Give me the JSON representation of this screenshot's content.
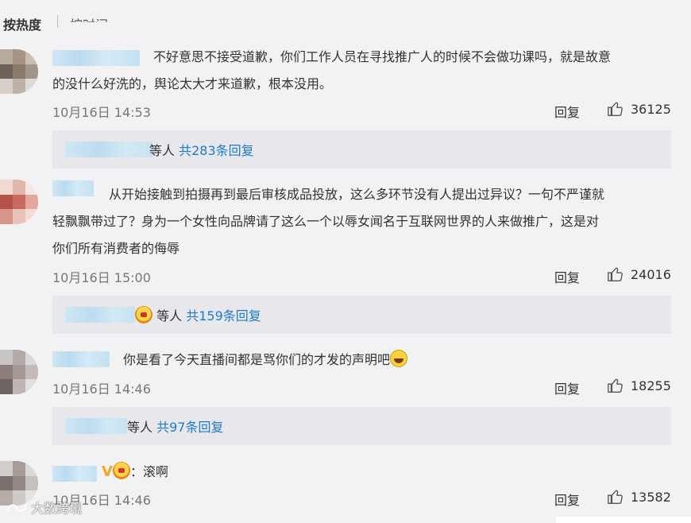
{
  "sort": {
    "active": "按热度",
    "other": "按时间"
  },
  "comments": [
    {
      "text_line1": "不好意思不接受道歉，你们工作人员在寻找推广人的时候不会做功课吗，就是故意",
      "text_line2": "的没什么好洗的，舆论太大才来道歉，根本没用。",
      "time": "10月16日 14:53",
      "reply_label": "回复",
      "likes": "36125",
      "replies": {
        "suffix": "等人",
        "count": "共283条回复"
      }
    },
    {
      "text_line1": "从开始接触到拍摄再到最后审核成品投放，这么多环节没有人提出过异议？一句不严谨就",
      "text_line2": "轻飘飘带过了？身为一个女性向品牌请了这么一个以辱女闻名于互联网世界的人来做推广，这是对",
      "text_line3": "你们所有消费者的侮辱",
      "time": "10月16日 15:00",
      "reply_label": "回复",
      "likes": "24016",
      "replies": {
        "suffix": "等人",
        "count": "共159条回复"
      }
    },
    {
      "text_line1": "你是看了今天直播间都是骂你们的才发的声明吧",
      "time": "10月16日 14:46",
      "reply_label": "回复",
      "likes": "18255",
      "replies": {
        "suffix": "等人",
        "count": "共97条回复"
      }
    },
    {
      "text_line1": "：滚啊",
      "time": "10月16日 14:46",
      "reply_label": "回复",
      "likes": "13582"
    }
  ],
  "watermark": "大数跨境",
  "colors": {
    "background": "#f2f2f5",
    "link": "#1c7bd1",
    "reply_box": "#e8e8ec"
  }
}
